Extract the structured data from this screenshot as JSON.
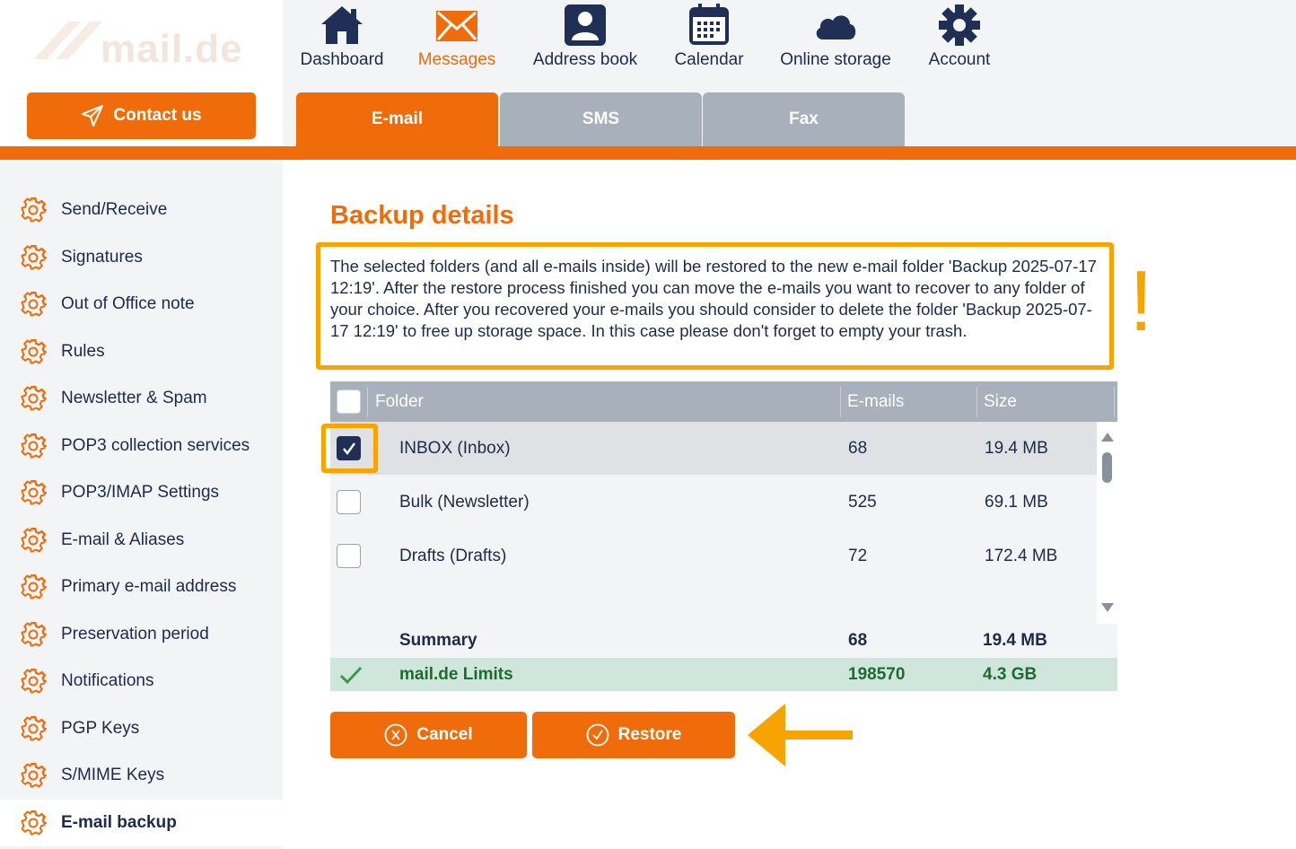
{
  "logo": {
    "text": "mail.de"
  },
  "topnav": [
    {
      "label": "Dashboard",
      "icon": "home-icon",
      "active": false
    },
    {
      "label": "Messages",
      "icon": "envelope-icon",
      "active": true
    },
    {
      "label": "Address book",
      "icon": "contact-card-icon",
      "active": false
    },
    {
      "label": "Calendar",
      "icon": "calendar-icon",
      "active": false
    },
    {
      "label": "Online storage",
      "icon": "cloud-icon",
      "active": false
    },
    {
      "label": "Account",
      "icon": "gear-icon",
      "active": false
    }
  ],
  "contact_button": {
    "label": "Contact us",
    "icon": "paper-plane-icon"
  },
  "tabs": [
    {
      "label": "E-mail",
      "active": true
    },
    {
      "label": "SMS",
      "active": false
    },
    {
      "label": "Fax",
      "active": false
    }
  ],
  "sidebar": {
    "items": [
      {
        "label": "Send/Receive"
      },
      {
        "label": "Signatures"
      },
      {
        "label": "Out of Office note"
      },
      {
        "label": "Rules"
      },
      {
        "label": "Newsletter & Spam"
      },
      {
        "label": "POP3 collection services"
      },
      {
        "label": "POP3/IMAP Settings"
      },
      {
        "label": "E-mail & Aliases"
      },
      {
        "label": "Primary e-mail address"
      },
      {
        "label": "Preservation period"
      },
      {
        "label": "Notifications"
      },
      {
        "label": "PGP Keys"
      },
      {
        "label": "S/MIME Keys"
      },
      {
        "label": "E-mail backup",
        "active": true
      }
    ]
  },
  "main": {
    "title": "Backup details",
    "info_text": "The selected folders (and all e-mails inside) will be restored to the new e-mail folder 'Backup 2025-07-17 12:19'. After the restore process finished you can move the e-mails you want to recover to any folder of your choice. After you recovered your e-mails you should consider to delete the folder 'Backup 2025-07-17 12:19' to free up storage space. In this case please don't forget to empty your trash.",
    "exclaim": "!",
    "table": {
      "headers": {
        "folder": "Folder",
        "emails": "E-mails",
        "size": "Size"
      },
      "rows": [
        {
          "folder": "INBOX (Inbox)",
          "emails": "68",
          "size": "19.4 MB",
          "checked": true
        },
        {
          "folder": "Bulk (Newsletter)",
          "emails": "525",
          "size": "69.1 MB",
          "checked": false
        },
        {
          "folder": "Drafts (Drafts)",
          "emails": "72",
          "size": "172.4 MB",
          "checked": false
        }
      ],
      "summary": {
        "label": "Summary",
        "emails": "68",
        "size": "19.4 MB"
      },
      "limits": {
        "label": "mail.de Limits",
        "emails": "198570",
        "size": "4.3 GB"
      }
    },
    "buttons": {
      "cancel": "Cancel",
      "restore": "Restore"
    }
  },
  "colors": {
    "accent": "#f06c0a",
    "highlight": "#f7a300",
    "navy": "#1e2a4a",
    "gray_tab": "#a8b0bb",
    "limits_bg": "#cfe6dc"
  }
}
